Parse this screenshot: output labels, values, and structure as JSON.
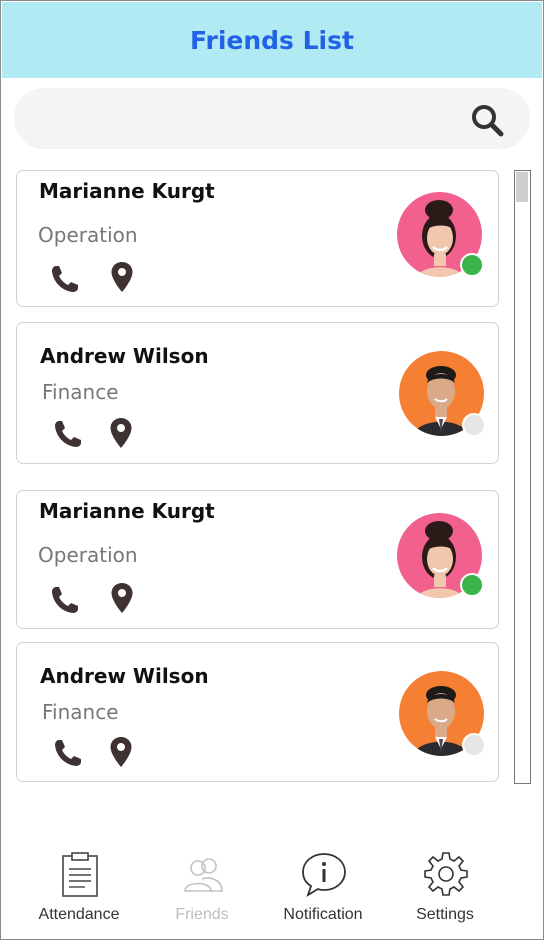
{
  "header": {
    "title": "Friends List"
  },
  "search": {
    "placeholder": "",
    "value": ""
  },
  "friends": [
    {
      "name": "Marianne Kurgt",
      "department": "Operation",
      "status": "online",
      "avatar_bg": "#f2618d"
    },
    {
      "name": "Andrew Wilson",
      "department": "Finance",
      "status": "offline",
      "avatar_bg": "#f57f32"
    },
    {
      "name": "Marianne Kurgt",
      "department": "Operation",
      "status": "online",
      "avatar_bg": "#f2618d"
    },
    {
      "name": "Andrew Wilson",
      "department": "Finance",
      "status": "offline",
      "avatar_bg": "#f57f32"
    }
  ],
  "nav": {
    "items": [
      {
        "label": "Attendance",
        "icon": "clipboard-icon",
        "active": false
      },
      {
        "label": "Friends",
        "icon": "friends-icon",
        "active": true
      },
      {
        "label": "Notification",
        "icon": "info-bubble-icon",
        "active": false
      },
      {
        "label": "Settings",
        "icon": "gear-icon",
        "active": false
      }
    ]
  },
  "colors": {
    "header_bg": "#b2eaf3",
    "title": "#2162e6",
    "online": "#3bb54a",
    "offline": "#e6e6e6",
    "nav_inactive_label": "#bdbdbd"
  }
}
